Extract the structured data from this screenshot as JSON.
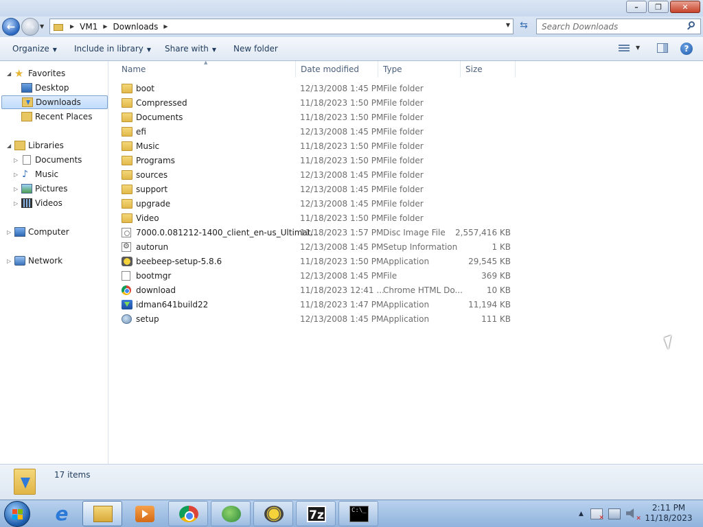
{
  "window": {
    "controls": {
      "minimize": "minimize",
      "maximize": "maximize",
      "close": "close"
    }
  },
  "address": {
    "crumbs": [
      "VM1",
      "Downloads"
    ]
  },
  "search": {
    "placeholder": "Search Downloads"
  },
  "toolbar": {
    "organize": "Organize",
    "include": "Include in library",
    "share": "Share with",
    "new_folder": "New folder"
  },
  "nav": {
    "favorites": "Favorites",
    "desktop": "Desktop",
    "downloads": "Downloads",
    "recent": "Recent Places",
    "libraries": "Libraries",
    "documents": "Documents",
    "music": "Music",
    "pictures": "Pictures",
    "videos": "Videos",
    "computer": "Computer",
    "network": "Network"
  },
  "columns": {
    "name": "Name",
    "date": "Date modified",
    "type": "Type",
    "size": "Size"
  },
  "files": [
    {
      "name": "boot",
      "date": "12/13/2008 1:45 PM",
      "type": "File folder",
      "size": "",
      "icon": "folder-icon"
    },
    {
      "name": "Compressed",
      "date": "11/18/2023 1:50 PM",
      "type": "File folder",
      "size": "",
      "icon": "folder-icon"
    },
    {
      "name": "Documents",
      "date": "11/18/2023 1:50 PM",
      "type": "File folder",
      "size": "",
      "icon": "folder-icon"
    },
    {
      "name": "efi",
      "date": "12/13/2008 1:45 PM",
      "type": "File folder",
      "size": "",
      "icon": "folder-icon"
    },
    {
      "name": "Music",
      "date": "11/18/2023 1:50 PM",
      "type": "File folder",
      "size": "",
      "icon": "folder-icon"
    },
    {
      "name": "Programs",
      "date": "11/18/2023 1:50 PM",
      "type": "File folder",
      "size": "",
      "icon": "folder-icon"
    },
    {
      "name": "sources",
      "date": "12/13/2008 1:45 PM",
      "type": "File folder",
      "size": "",
      "icon": "folder-icon"
    },
    {
      "name": "support",
      "date": "12/13/2008 1:45 PM",
      "type": "File folder",
      "size": "",
      "icon": "folder-icon"
    },
    {
      "name": "upgrade",
      "date": "12/13/2008 1:45 PM",
      "type": "File folder",
      "size": "",
      "icon": "folder-icon"
    },
    {
      "name": "Video",
      "date": "11/18/2023 1:50 PM",
      "type": "File folder",
      "size": "",
      "icon": "folder-icon"
    },
    {
      "name": "7000.0.081212-1400_client_en-us_Ultimat...",
      "date": "11/18/2023 1:57 PM",
      "type": "Disc Image File",
      "size": "2,557,416 KB",
      "icon": "disc-image-icon"
    },
    {
      "name": "autorun",
      "date": "12/13/2008 1:45 PM",
      "type": "Setup Information",
      "size": "1 KB",
      "icon": "settings-file-icon"
    },
    {
      "name": "beebeep-setup-5.8.6",
      "date": "11/18/2023 1:50 PM",
      "type": "Application",
      "size": "29,545 KB",
      "icon": "bee-app-icon"
    },
    {
      "name": "bootmgr",
      "date": "12/13/2008 1:45 PM",
      "type": "File",
      "size": "369 KB",
      "icon": "file-icon"
    },
    {
      "name": "download",
      "date": "11/18/2023 12:41 ...",
      "type": "Chrome HTML Do...",
      "size": "10 KB",
      "icon": "chrome-icon"
    },
    {
      "name": "idman641build22",
      "date": "11/18/2023 1:47 PM",
      "type": "Application",
      "size": "11,194 KB",
      "icon": "idm-app-icon"
    },
    {
      "name": "setup",
      "date": "12/13/2008 1:45 PM",
      "type": "Application",
      "size": "111 KB",
      "icon": "setup-app-icon"
    }
  ],
  "status": {
    "count": "17 items"
  },
  "clock": {
    "time": "2:11 PM",
    "date": "11/18/2023"
  },
  "taskbar": {
    "sevenzip": "7z",
    "cmd": "C:\\_"
  }
}
